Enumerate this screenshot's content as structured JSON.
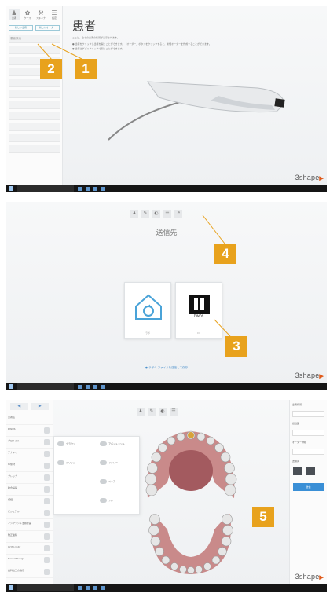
{
  "screen1": {
    "tabs": [
      {
        "label": "患者",
        "icon": "person-icon"
      },
      {
        "label": "ケース",
        "icon": "tooth-icon"
      },
      {
        "label": "スキャナ",
        "icon": "scanner-icon"
      },
      {
        "label": "設定",
        "icon": "menu-icon"
      }
    ],
    "side_buttons": [
      "新しい患者",
      "新しいオーダー"
    ],
    "patients": [
      "患者検索",
      "",
      "",
      "",
      "",
      "",
      "",
      "",
      "",
      "",
      ""
    ],
    "title": "患者",
    "line1": "ここは、全ての患者の情報が表示されます。",
    "line2": "● 患者をクリックし患者を開くことができます。「オーダー」ボタンをクリックすると、新規オーダーを作成することができます。",
    "line3": "● 患者はダブルクリックで開くことができます。",
    "brand": "3shape",
    "badges": [
      "2",
      "1"
    ]
  },
  "screen2": {
    "title": "送信先",
    "cards": [
      {
        "label": "ラボ",
        "icon": "home-sync-icon"
      },
      {
        "label": "DI",
        "sub": "DWOS",
        "icon": "di-logo"
      }
    ],
    "footer": "● ラボへ  ファイルを送信して保存",
    "brand": "3shape",
    "badges": [
      "4",
      "3"
    ]
  },
  "screen3": {
    "left_list": [
      "患者名",
      "DWOS",
      "プロトコル",
      "アナトミー",
      "印象材",
      "プレップ",
      "咬合採得",
      "補綴",
      "ビジュアル",
      "インプラント治療計画",
      "矯正歯科",
      "Ortho Indir",
      "Dental Design",
      "歯科技工の指示"
    ],
    "flyout": [
      "クラウン",
      "アバットメント",
      "ブリッジ",
      "インレー",
      "ベニア",
      "フル"
    ],
    "right_panel": [
      "患者情報",
      "担当医",
      "オーダー詳細",
      "送信先",
      "送信"
    ],
    "brand": "3shape",
    "badge": "5"
  }
}
